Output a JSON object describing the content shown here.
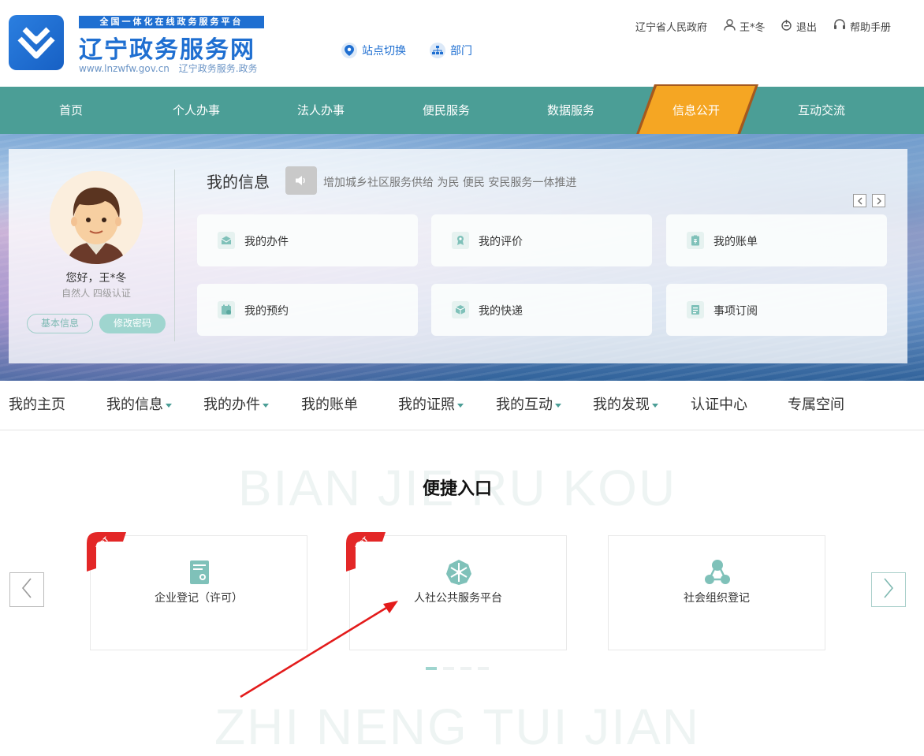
{
  "header": {
    "logo_tag": "全国一体化在线政务服务平台",
    "logo_title": "辽宁政务服务网",
    "logo_url": "www.lnzwfw.gov.cn",
    "logo_domain": "辽宁政务服务.政务",
    "site_switch": "站点切换",
    "department": "部门",
    "gov_link": "辽宁省人民政府",
    "user_name": "王*冬",
    "logout": "退出",
    "help": "帮助手册"
  },
  "main_nav": {
    "items": [
      "首页",
      "个人办事",
      "法人办事",
      "便民服务",
      "数据服务",
      "信息公开",
      "互动交流"
    ],
    "active_index": 5,
    "active_color": "#f5a623",
    "bar_color": "#4b9e96"
  },
  "profile": {
    "greeting": "您好，王*冬",
    "level": "自然人  四级认证",
    "basic_info": "基本信息",
    "change_password": "修改密码"
  },
  "my_info": {
    "title": "我的信息",
    "notice": "增加城乡社区服务供给 为民 便民 安民服务一体推进",
    "prev_icon": "chevron-left-icon",
    "next_icon": "chevron-right-icon",
    "cards": [
      {
        "label": "我的办件",
        "icon": "mail-icon"
      },
      {
        "label": "我的评价",
        "icon": "evaluate-icon"
      },
      {
        "label": "我的账单",
        "icon": "bill-icon"
      },
      {
        "label": "我的预约",
        "icon": "appointment-icon"
      },
      {
        "label": "我的快递",
        "icon": "package-icon"
      },
      {
        "label": "事项订阅",
        "icon": "subscribe-icon"
      }
    ]
  },
  "sub_nav": {
    "items": [
      {
        "label": "我的主页",
        "dropdown": false
      },
      {
        "label": "我的信息",
        "dropdown": true
      },
      {
        "label": "我的办件",
        "dropdown": true
      },
      {
        "label": "我的账单",
        "dropdown": false
      },
      {
        "label": "我的证照",
        "dropdown": true
      },
      {
        "label": "我的互动",
        "dropdown": true
      },
      {
        "label": "我的发现",
        "dropdown": true
      },
      {
        "label": "认证中心",
        "dropdown": false
      },
      {
        "label": "专属空间",
        "dropdown": false
      }
    ]
  },
  "quick_entry": {
    "bg_word": "BIAN JIE RU KOU",
    "title": "便捷入口",
    "hot_label": "HOT",
    "cards": [
      {
        "label": "企业登记（许可）",
        "hot": true,
        "icon": "certificate-icon"
      },
      {
        "label": "人社公共服务平台",
        "hot": true,
        "icon": "social-security-icon"
      },
      {
        "label": "社会组织登记",
        "hot": false,
        "icon": "organization-icon"
      }
    ],
    "dots_total": 4,
    "dots_active": 0
  },
  "next_section": {
    "bg_word": "ZHI NENG TUI JIAN"
  }
}
